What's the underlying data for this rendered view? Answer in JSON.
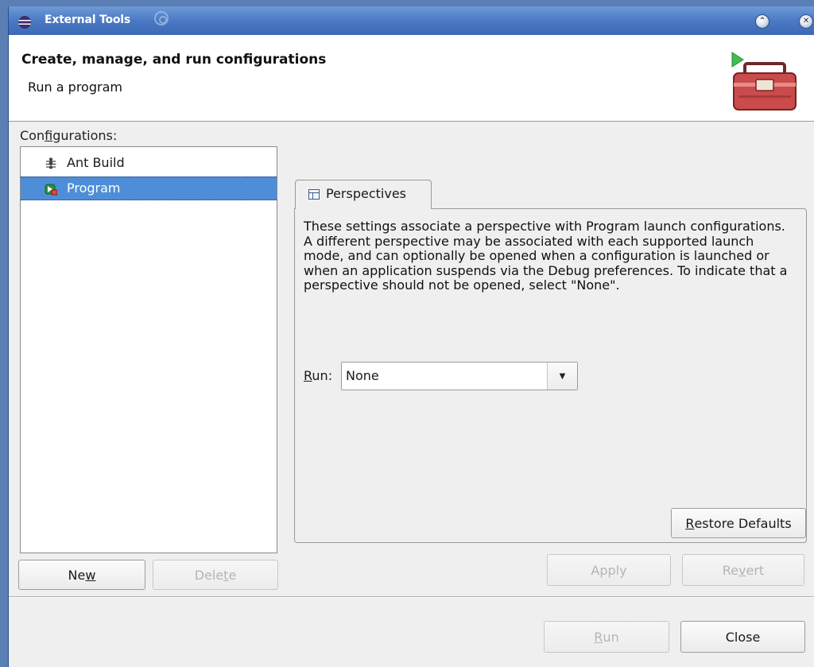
{
  "window": {
    "title": "External Tools",
    "minimize_glyph": "⌃",
    "close_glyph": "✕"
  },
  "header": {
    "title": "Create, manage, and run configurations",
    "subtitle": "Run a program"
  },
  "configurations": {
    "label_pre": "Con",
    "label_mnemonic": "f",
    "label_post": "igurations:",
    "items": [
      {
        "label": "Ant Build",
        "icon": "ant-icon",
        "selected": false
      },
      {
        "label": "Program",
        "icon": "program-launch-icon",
        "selected": true
      }
    ],
    "new_pre": "Ne",
    "new_mnemonic": "w",
    "new_post": "",
    "delete_pre": "Dele",
    "delete_mnemonic": "t",
    "delete_post": "e"
  },
  "tab": {
    "label": "Perspectives",
    "icon": "perspective-icon"
  },
  "perspectives": {
    "description": "These settings associate a perspective with Program launch configurations. A different perspective may be associated with each supported launch mode, and can optionally be opened when a configuration is launched or when an application suspends via the Debug preferences. To indicate that a perspective should not be opened, select \"None\".",
    "run_label_mnemonic": "R",
    "run_label_rest": "un:",
    "run_value": "None",
    "restore_pre": "",
    "restore_mnemonic": "R",
    "restore_post": "estore Defaults"
  },
  "actions": {
    "apply_label": "Apply",
    "revert_pre": "Re",
    "revert_mnemonic": "v",
    "revert_post": "ert",
    "run_mnemonic": "R",
    "run_post": "un",
    "close_label": "Close"
  },
  "colors": {
    "titlebar": "#4b79c4",
    "selection": "#4e8ed8",
    "dialog_bg": "#efefef"
  }
}
